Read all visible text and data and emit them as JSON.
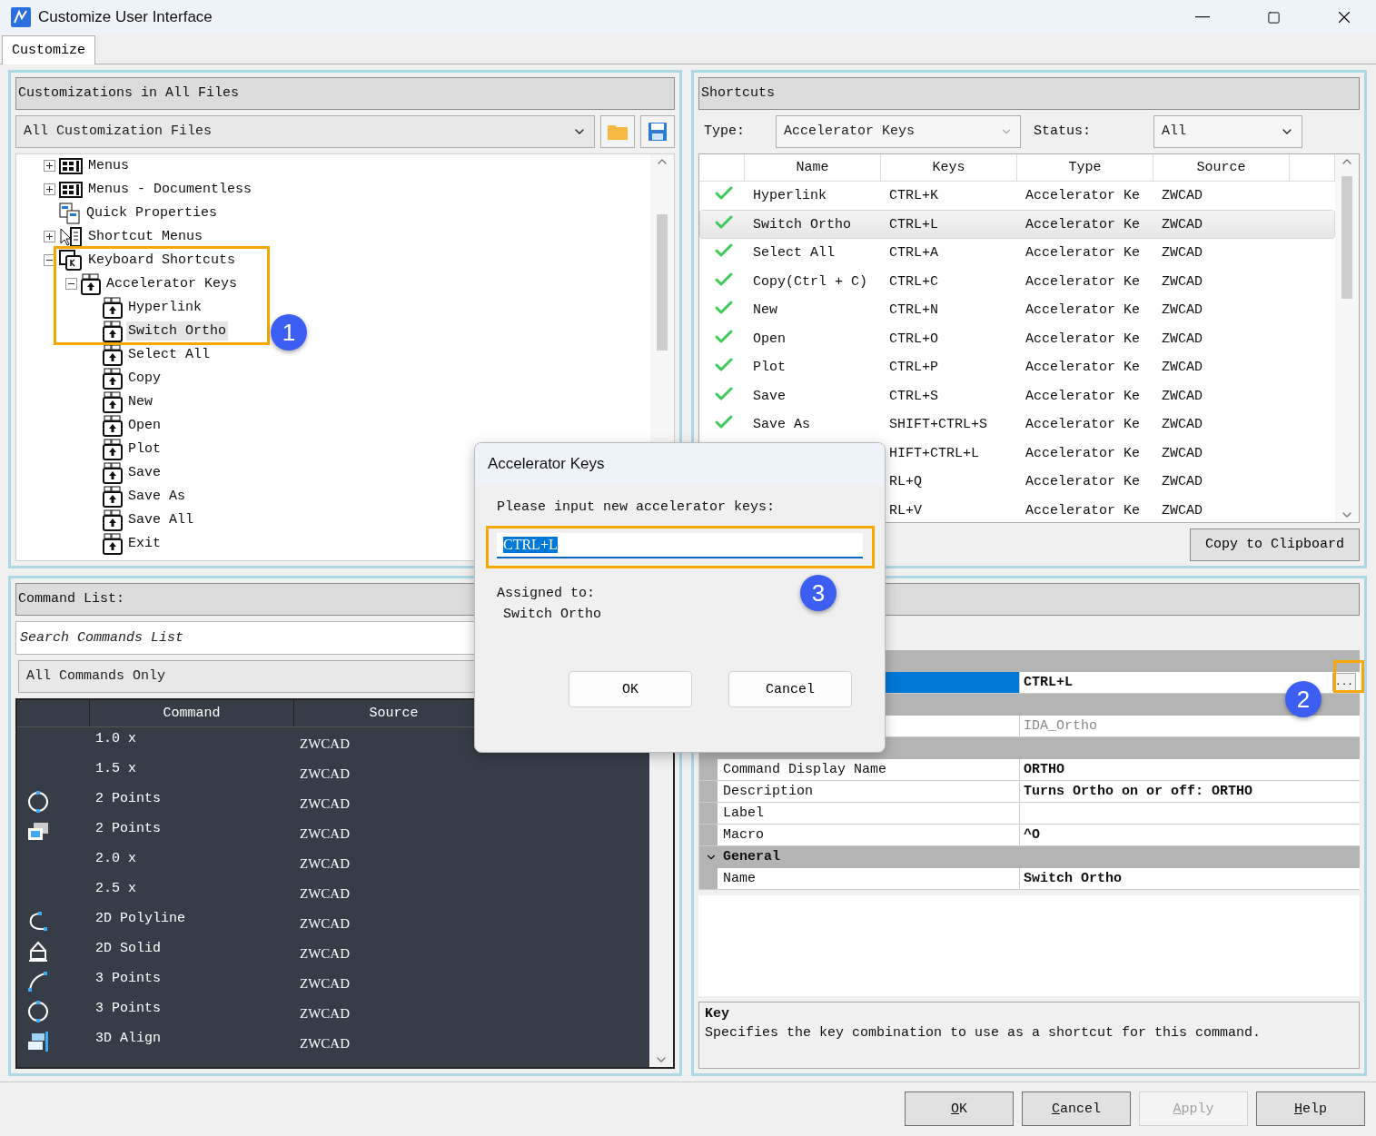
{
  "window": {
    "title": "Customize User Interface"
  },
  "tabs": [
    {
      "label": "Customize",
      "selected": true
    }
  ],
  "customizations": {
    "title": "Customizations in All Files",
    "file_select": "All Customization Files",
    "tree": [
      {
        "label": "Menus",
        "kind": "menu",
        "expanded": false,
        "selected": false
      },
      {
        "label": "Menus - Documentless",
        "kind": "menu",
        "expanded": false,
        "selected": false
      },
      {
        "label": "Quick Properties",
        "kind": "quick-properties",
        "selected": false
      },
      {
        "label": "Shortcut Menus",
        "kind": "shortcut-menu",
        "expanded": false,
        "selected": false
      },
      {
        "label": "Keyboard Shortcuts",
        "kind": "keyboard",
        "expanded": true,
        "selected": false,
        "children": [
          {
            "label": "Accelerator Keys",
            "kind": "accelerator",
            "expanded": true,
            "selected": false,
            "children": [
              {
                "label": "Hyperlink",
                "kind": "key",
                "selected": false
              },
              {
                "label": "Switch Ortho",
                "kind": "key",
                "selected": true
              },
              {
                "label": "Select All",
                "kind": "key",
                "selected": false
              },
              {
                "label": "Copy",
                "kind": "key",
                "selected": false
              },
              {
                "label": "New",
                "kind": "key",
                "selected": false
              },
              {
                "label": "Open",
                "kind": "key",
                "selected": false
              },
              {
                "label": "Plot",
                "kind": "key",
                "selected": false
              },
              {
                "label": "Save",
                "kind": "key",
                "selected": false
              },
              {
                "label": "Save As",
                "kind": "key",
                "selected": false
              },
              {
                "label": "Save All",
                "kind": "key",
                "selected": false
              },
              {
                "label": "Exit",
                "kind": "key",
                "selected": false
              }
            ]
          }
        ]
      }
    ]
  },
  "shortcuts": {
    "title": "Shortcuts",
    "type_label": "Type:",
    "type_value": "Accelerator Keys",
    "status_label": "Status:",
    "status_value": "All",
    "columns": [
      "Name",
      "Keys",
      "Type",
      "Source"
    ],
    "rows": [
      {
        "checked": true,
        "selected": false,
        "cells": [
          "Hyperlink",
          "CTRL+K",
          "Accelerator Ke",
          "ZWCAD"
        ]
      },
      {
        "checked": true,
        "selected": true,
        "cells": [
          "Switch Ortho",
          "CTRL+L",
          "Accelerator Ke",
          "ZWCAD"
        ]
      },
      {
        "checked": true,
        "selected": false,
        "cells": [
          "Select All",
          "CTRL+A",
          "Accelerator Ke",
          "ZWCAD"
        ]
      },
      {
        "checked": true,
        "selected": false,
        "cells": [
          "Copy(Ctrl + C)",
          "CTRL+C",
          "Accelerator Ke",
          "ZWCAD"
        ]
      },
      {
        "checked": true,
        "selected": false,
        "cells": [
          "New",
          "CTRL+N",
          "Accelerator Ke",
          "ZWCAD"
        ]
      },
      {
        "checked": true,
        "selected": false,
        "cells": [
          "Open",
          "CTRL+O",
          "Accelerator Ke",
          "ZWCAD"
        ]
      },
      {
        "checked": true,
        "selected": false,
        "cells": [
          "Plot",
          "CTRL+P",
          "Accelerator Ke",
          "ZWCAD"
        ]
      },
      {
        "checked": true,
        "selected": false,
        "cells": [
          "Save",
          "CTRL+S",
          "Accelerator Ke",
          "ZWCAD"
        ]
      },
      {
        "checked": true,
        "selected": false,
        "cells": [
          "Save As",
          "SHIFT+CTRL+S",
          "Accelerator Ke",
          "ZWCAD"
        ]
      },
      {
        "selected": false,
        "cells": [
          "",
          "HIFT+CTRL+L",
          "Accelerator Ke",
          "ZWCAD"
        ]
      },
      {
        "selected": false,
        "cells": [
          "",
          "RL+Q",
          "Accelerator Ke",
          "ZWCAD"
        ]
      },
      {
        "selected": false,
        "cells": [
          "",
          "RL+V",
          "Accelerator Ke",
          "ZWCAD"
        ]
      }
    ],
    "copy_button": "Copy to Clipboard"
  },
  "command_list": {
    "title": "Command List:",
    "search_placeholder": "Search Commands List",
    "filter": "All Commands Only",
    "columns": [
      "Command",
      "Source"
    ],
    "rows": [
      {
        "kind": "plain",
        "command": "1.0 x",
        "source": "ZWCAD"
      },
      {
        "kind": "plain",
        "command": "1.5 x",
        "source": "ZWCAD"
      },
      {
        "kind": "circle",
        "command": "2 Points",
        "source": "ZWCAD"
      },
      {
        "kind": "boxes",
        "command": "2 Points",
        "source": "ZWCAD"
      },
      {
        "kind": "plain",
        "command": "2.0 x",
        "source": "ZWCAD"
      },
      {
        "kind": "plain",
        "command": "2.5 x",
        "source": "ZWCAD"
      },
      {
        "kind": "polyline",
        "command": "2D Polyline",
        "source": "ZWCAD"
      },
      {
        "kind": "solid",
        "command": "2D Solid",
        "source": "ZWCAD"
      },
      {
        "kind": "arc",
        "command": "3 Points",
        "source": "ZWCAD"
      },
      {
        "kind": "circle",
        "command": "3 Points",
        "source": "ZWCAD"
      },
      {
        "kind": "align",
        "command": "3D Align",
        "source": "ZWCAD"
      }
    ]
  },
  "properties": {
    "rows": [
      {
        "kind": "category"
      },
      {
        "kind": "property",
        "value": "CTRL+L",
        "selected": true,
        "disabled": false,
        "button": "..."
      },
      {
        "kind": "category"
      },
      {
        "kind": "property",
        "value": "IDA_Ortho",
        "selected": false,
        "disabled": true
      },
      {
        "kind": "category"
      },
      {
        "kind": "property",
        "name": "Command Display Name",
        "value": "ORTHO",
        "selected": false,
        "disabled": false
      },
      {
        "kind": "property",
        "name": "Description",
        "value": "Turns Ortho on or off: ORTHO",
        "selected": false,
        "disabled": false
      },
      {
        "kind": "property",
        "name": "Label",
        "selected": false
      },
      {
        "kind": "property",
        "name": "Macro",
        "value": "^O",
        "selected": false,
        "disabled": false
      },
      {
        "kind": "category",
        "name": "General",
        "expanded": true
      },
      {
        "kind": "property",
        "name": "Name",
        "value": "Switch Ortho",
        "selected": false,
        "disabled": false
      }
    ],
    "help_title": "Key",
    "help_text": "Specifies the key combination to use as a shortcut for this command."
  },
  "footer_buttons": [
    {
      "label": "OK",
      "disabled": false,
      "mnemonic": true
    },
    {
      "label": "Cancel",
      "disabled": false,
      "mnemonic": true
    },
    {
      "label": "Apply",
      "disabled": true,
      "mnemonic": true
    },
    {
      "label": "Help",
      "disabled": false,
      "mnemonic": true
    }
  ],
  "dialog": {
    "title": "Accelerator Keys",
    "prompt": "Please input new accelerator keys:",
    "value": "CTRL+L",
    "value_selected": true,
    "assigned_label": "Assigned to:",
    "assigned_value": "Switch Ortho",
    "buttons": [
      "OK",
      "Cancel"
    ]
  },
  "callouts": [
    {
      "number": "1"
    },
    {
      "number": "2"
    },
    {
      "number": "3"
    }
  ]
}
